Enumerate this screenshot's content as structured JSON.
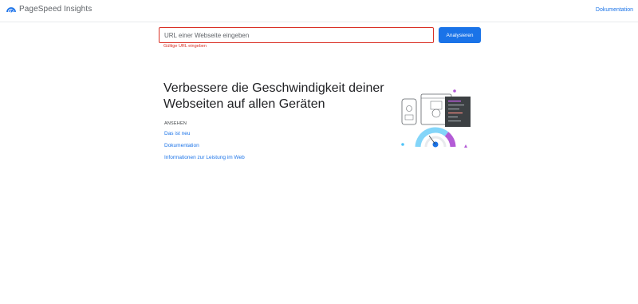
{
  "header": {
    "app_title": "PageSpeed Insights",
    "doc_link": "Dokumentation"
  },
  "search": {
    "placeholder": "URL einer Webseite eingeben",
    "value": "",
    "error": "Gültige URL eingeben",
    "analyze_label": "Analysieren"
  },
  "hero": {
    "title": "Verbessere die Geschwindigkeit deiner Webseiten auf allen Geräten",
    "see_label": "ANSEHEN",
    "links": [
      {
        "label": "Das ist neu"
      },
      {
        "label": "Dokumentation"
      },
      {
        "label": "Informationen zur Leistung im Web"
      }
    ]
  },
  "colors": {
    "accent": "#1a73e8",
    "error": "#d93025",
    "gauge_blue": "#4fc3f7",
    "gauge_purple": "#b35bd6"
  }
}
